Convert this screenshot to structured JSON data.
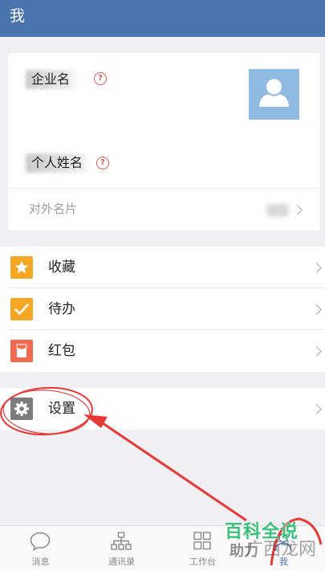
{
  "header": {
    "title": "我"
  },
  "profile": {
    "company_label": "企业名",
    "person_label": "个人姓名",
    "help_glyph": "?",
    "business_card_label": "对外名片"
  },
  "menu": {
    "group1": [
      {
        "label": "收藏",
        "icon": "star-icon",
        "color": "#f5a623"
      },
      {
        "label": "待办",
        "icon": "check-icon",
        "color": "#f5a623"
      },
      {
        "label": "红包",
        "icon": "red-envelope-icon",
        "color": "#f26a4f"
      }
    ],
    "settings": {
      "label": "设置",
      "icon": "gear-icon",
      "color": "#7c7c7c"
    }
  },
  "tabbar": {
    "tabs": [
      {
        "label": "消息",
        "icon": "chat-bubble-icon"
      },
      {
        "label": "通讯录",
        "icon": "org-chart-icon"
      },
      {
        "label": "工作台",
        "icon": "grid-icon"
      },
      {
        "label": "我",
        "icon": "me-icon"
      }
    ]
  },
  "watermark": {
    "line1": "百科全说",
    "line2": "广西龙网",
    "partial": "助力"
  },
  "colors": {
    "header": "#4a74ad",
    "annotation": "#e53935",
    "watermark_green": "#36c07a"
  }
}
